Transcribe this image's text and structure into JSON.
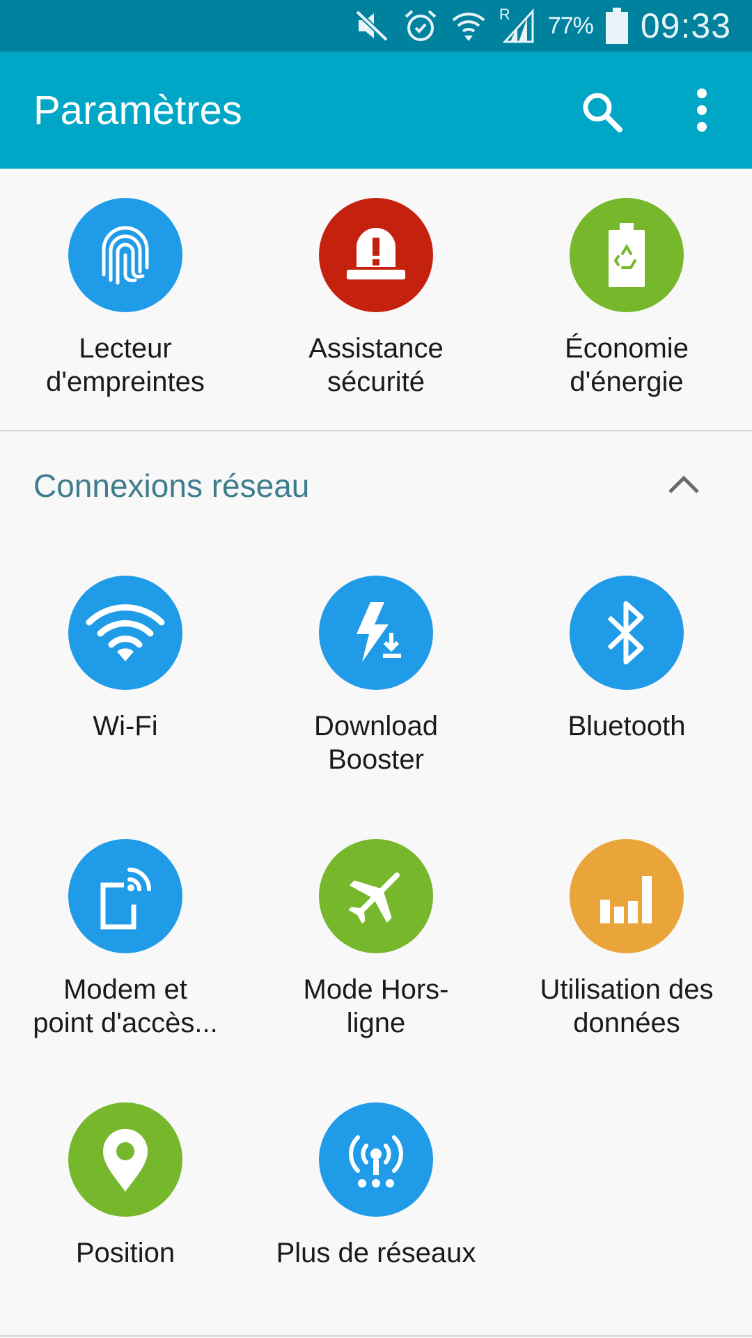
{
  "status_bar": {
    "battery_percent": "77%",
    "time": "09:33",
    "roaming_indicator": "R",
    "icons": [
      "mute-icon",
      "alarm-icon",
      "wifi-signal-icon",
      "cell-signal-icon",
      "battery-icon"
    ]
  },
  "app_bar": {
    "title": "Paramètres",
    "icons": [
      "search-icon",
      "more-vert-icon"
    ]
  },
  "quick_settings": [
    {
      "label": "Lecteur\nd'empreintes",
      "icon": "fingerprint-icon",
      "color": "#1f9be8"
    },
    {
      "label": "Assistance\nsécurité",
      "icon": "emergency-alert-icon",
      "color": "#c4210e"
    },
    {
      "label": "Économie\nd'énergie",
      "icon": "battery-recycle-icon",
      "color": "#77b72b"
    }
  ],
  "section": {
    "title": "Connexions réseau",
    "toggle_icon": "chevron-up-icon",
    "items": [
      {
        "label": "Wi-Fi",
        "icon": "wifi-icon",
        "color": "#1f9be8"
      },
      {
        "label": "Download\nBooster",
        "icon": "download-booster-icon",
        "color": "#1f9be8"
      },
      {
        "label": "Bluetooth",
        "icon": "bluetooth-icon",
        "color": "#1f9be8"
      },
      {
        "label": "Modem et\npoint d'accès...",
        "icon": "hotspot-icon",
        "color": "#1f9be8"
      },
      {
        "label": "Mode Hors-\nligne",
        "icon": "airplane-icon",
        "color": "#77b72b"
      },
      {
        "label": "Utilisation des\ndonnées",
        "icon": "data-usage-icon",
        "color": "#e9a53a"
      },
      {
        "label": "Position",
        "icon": "location-pin-icon",
        "color": "#77b72b"
      },
      {
        "label": "Plus de réseaux",
        "icon": "more-networks-icon",
        "color": "#1f9be8"
      }
    ]
  }
}
